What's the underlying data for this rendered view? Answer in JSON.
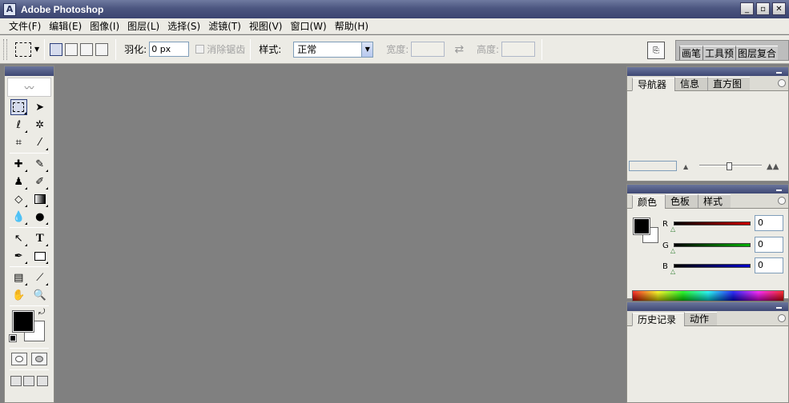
{
  "window": {
    "title": "Adobe Photoshop",
    "icon_letter": "A"
  },
  "menu": [
    "文件(F)",
    "编辑(E)",
    "图像(I)",
    "图层(L)",
    "选择(S)",
    "滤镜(T)",
    "视图(V)",
    "窗口(W)",
    "帮助(H)"
  ],
  "options": {
    "feather_label": "羽化:",
    "feather_value": "0 px",
    "antialias_label": "消除锯齿",
    "style_label": "样式:",
    "style_value": "正常",
    "width_label": "宽度:",
    "height_label": "高度:"
  },
  "palette_well": [
    "画笔",
    "工具预",
    "图层复合"
  ],
  "panels": {
    "navigator_tabs": [
      "导航器",
      "信息",
      "直方图"
    ],
    "color_tabs": [
      "颜色",
      "色板",
      "样式"
    ],
    "history_tabs": [
      "历史记录",
      "动作"
    ],
    "color": {
      "r_label": "R",
      "g_label": "G",
      "b_label": "B",
      "r_value": "0",
      "g_value": "0",
      "b_value": "0",
      "slider_colors": {
        "r": "#cc0000",
        "g": "#00a000",
        "b": "#0000cc"
      }
    }
  },
  "colors": {
    "foreground": "#000000",
    "background": "#ffffff",
    "workspace": "#808080"
  },
  "icons": [
    "photoshop-icon",
    "marquee-icon",
    "feather-icon",
    "move-icon",
    "lasso-icon",
    "magic-wand-icon",
    "crop-icon",
    "slice-icon",
    "healing-brush-icon",
    "brush-icon",
    "clone-stamp-icon",
    "history-brush-icon",
    "eraser-icon",
    "gradient-icon",
    "blur-icon",
    "dodge-icon",
    "path-select-icon",
    "type-icon",
    "pen-icon",
    "shape-icon",
    "notes-icon",
    "eyedropper-icon",
    "hand-icon",
    "zoom-icon",
    "swap-colors-icon",
    "default-colors-icon"
  ]
}
